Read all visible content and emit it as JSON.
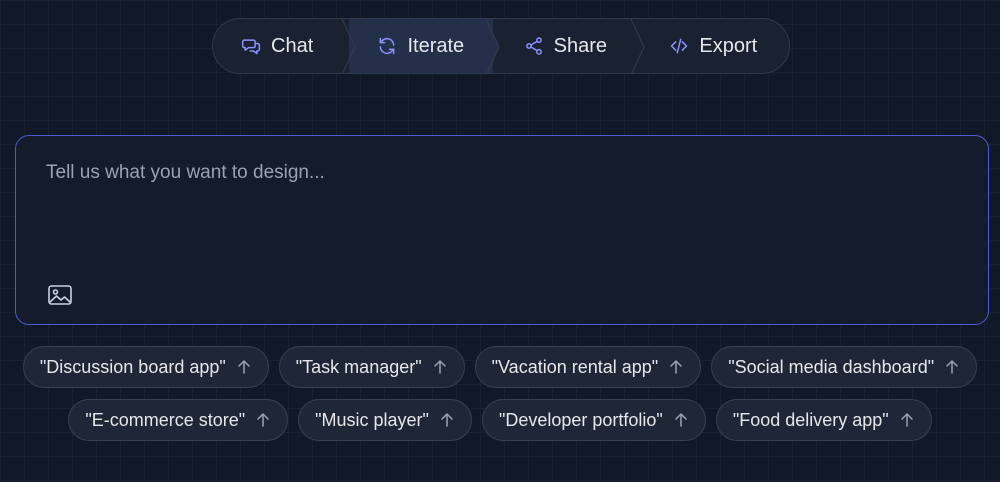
{
  "nav": {
    "steps": [
      {
        "label": "Chat",
        "icon": "chat-bubbles-icon",
        "active": false
      },
      {
        "label": "Iterate",
        "icon": "refresh-icon",
        "active": true
      },
      {
        "label": "Share",
        "icon": "share-icon",
        "active": false
      },
      {
        "label": "Export",
        "icon": "code-icon",
        "active": false
      }
    ]
  },
  "prompt": {
    "placeholder": "Tell us what you want to design...",
    "value": "",
    "attach_icon": "image-icon"
  },
  "suggestions": {
    "row1": [
      "\"Discussion board app\"",
      "\"Task manager\"",
      "\"Vacation rental app\"",
      "\"Social media dashboard\""
    ],
    "row2": [
      "\"E-commerce store\"",
      "\"Music player\"",
      "\"Developer portfolio\"",
      "\"Food delivery app\""
    ],
    "chip_icon": "arrow-up-icon"
  },
  "colors": {
    "background": "#111827",
    "accent": "#6b7cff",
    "prompt_border": "#4f5bd5",
    "active_step": "#243049"
  }
}
